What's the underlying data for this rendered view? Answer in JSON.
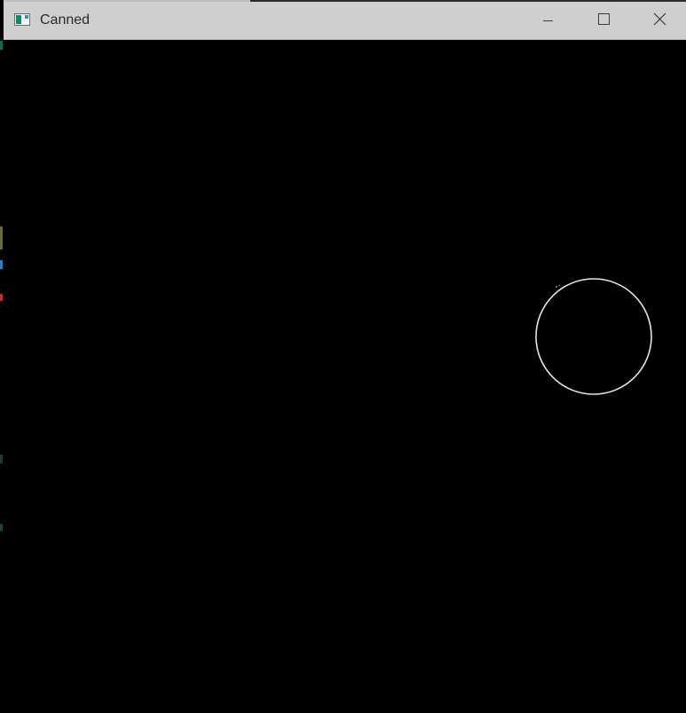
{
  "window": {
    "title": "Canned",
    "icon": "app-window-icon",
    "controls": {
      "minimize_icon": "minimize-icon",
      "maximize_icon": "maximize-icon",
      "close_icon": "close-icon"
    }
  },
  "canvas": {
    "background_color": "#000000",
    "shape": "circle",
    "stroke_color": "#e6e6e6"
  },
  "colors": {
    "titlebar": "#cfcfcf",
    "title_text": "#2a2a2a"
  }
}
